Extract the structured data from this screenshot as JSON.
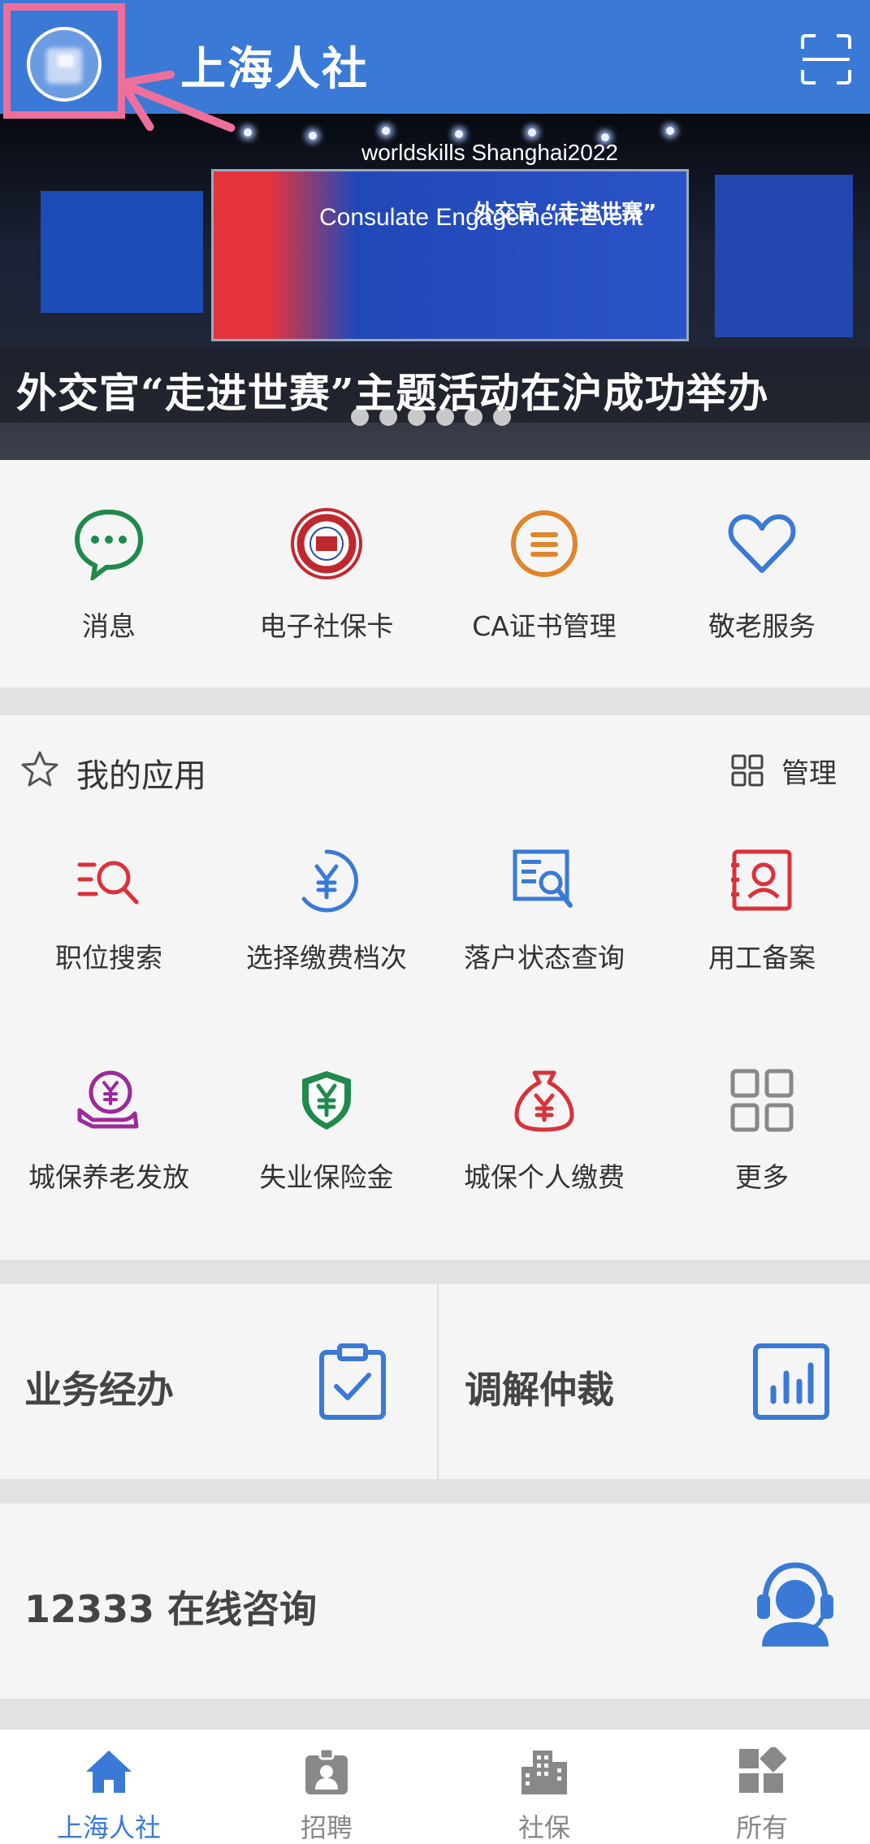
{
  "header": {
    "title": "上海人社",
    "avatar_icon": "avatar-icon",
    "scan_icon": "scan-icon",
    "highlight_color": "#ef6f9c",
    "bg_color": "#3a7ad6"
  },
  "banner": {
    "caption": "外交官“走进世赛”主题活动在沪成功举办",
    "logo_text": "worldskills Shanghai2022",
    "screen_title": "Consulate Engagement Event",
    "screen_subtitle": "外交官 “走进世赛”",
    "slide_count": 6
  },
  "quick": {
    "items": [
      {
        "label": "消息",
        "icon": "message-icon",
        "color": "#1f8a4c"
      },
      {
        "label": "电子社保卡",
        "icon": "social-security-card-icon",
        "color": "#c0282f"
      },
      {
        "label": "CA证书管理",
        "icon": "certificate-icon",
        "color": "#e0852a"
      },
      {
        "label": "敬老服务",
        "icon": "heart-icon",
        "color": "#3a7ad6"
      }
    ]
  },
  "my_apps": {
    "title": "我的应用",
    "manage_label": "管理",
    "items": [
      {
        "label": "职位搜索",
        "icon": "job-search-icon",
        "color": "#d9323a"
      },
      {
        "label": "选择缴费档次",
        "icon": "yuan-circle-icon",
        "color": "#3a7ad6"
      },
      {
        "label": "落户状态查询",
        "icon": "doc-search-icon",
        "color": "#3a7ad6"
      },
      {
        "label": "用工备案",
        "icon": "employee-record-icon",
        "color": "#d9323a"
      },
      {
        "label": "城保养老发放",
        "icon": "pension-hand-icon",
        "color": "#9b2a9b"
      },
      {
        "label": "失业保险金",
        "icon": "shield-yuan-icon",
        "color": "#1f8a4c"
      },
      {
        "label": "城保个人缴费",
        "icon": "money-bag-icon",
        "color": "#d9323a"
      },
      {
        "label": "更多",
        "icon": "grid-more-icon",
        "color": "#888888"
      }
    ]
  },
  "biz": {
    "left_label": "业务经办",
    "left_icon": "clipboard-check-icon",
    "right_label": "调解仲裁",
    "right_icon": "bar-chart-icon"
  },
  "consult": {
    "label": "12333 在线咨询",
    "icon": "headset-agent-icon"
  },
  "nav": {
    "items": [
      {
        "label": "上海人社",
        "icon": "home-icon",
        "active": true
      },
      {
        "label": "招聘",
        "icon": "badge-icon",
        "active": false
      },
      {
        "label": "社保",
        "icon": "building-icon",
        "active": false
      },
      {
        "label": "所有",
        "icon": "all-apps-icon",
        "active": false
      }
    ]
  }
}
